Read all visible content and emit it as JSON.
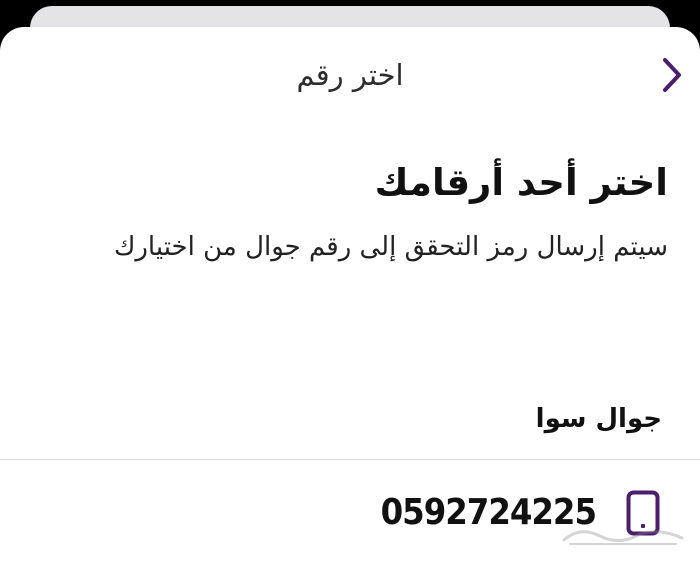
{
  "header": {
    "title": "اختر رقم",
    "back_icon": "chevron-right-icon"
  },
  "main": {
    "heading": "اختر أحد أرقامك",
    "subtitle": "سيتم إرسال رمز التحقق إلى رقم جوال من اختيارك"
  },
  "section": {
    "label": "جوال سوا"
  },
  "phone_entry": {
    "number": "0592724225",
    "icon": "mobile-phone-icon"
  },
  "colors": {
    "accent": "#4b1e6e",
    "background": "#ffffff",
    "text": "#111111",
    "divider": "#dcdcdc"
  }
}
